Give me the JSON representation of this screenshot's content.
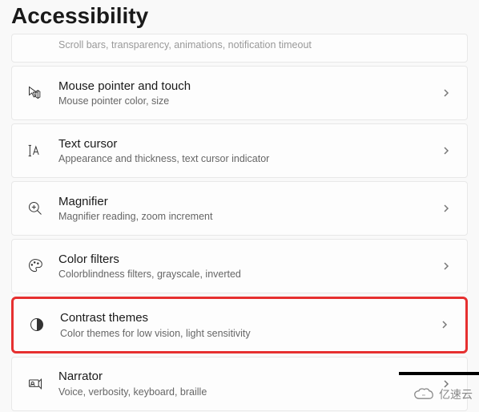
{
  "page": {
    "title": "Accessibility"
  },
  "items": [
    {
      "subtitle": "Scroll bars, transparency, animations, notification timeout"
    },
    {
      "title": "Mouse pointer and touch",
      "subtitle": "Mouse pointer color, size"
    },
    {
      "title": "Text cursor",
      "subtitle": "Appearance and thickness, text cursor indicator"
    },
    {
      "title": "Magnifier",
      "subtitle": "Magnifier reading, zoom increment"
    },
    {
      "title": "Color filters",
      "subtitle": "Colorblindness filters, grayscale, inverted"
    },
    {
      "title": "Contrast themes",
      "subtitle": "Color themes for low vision, light sensitivity"
    },
    {
      "title": "Narrator",
      "subtitle": "Voice, verbosity, keyboard, braille"
    }
  ],
  "watermark": {
    "text": "亿速云"
  }
}
